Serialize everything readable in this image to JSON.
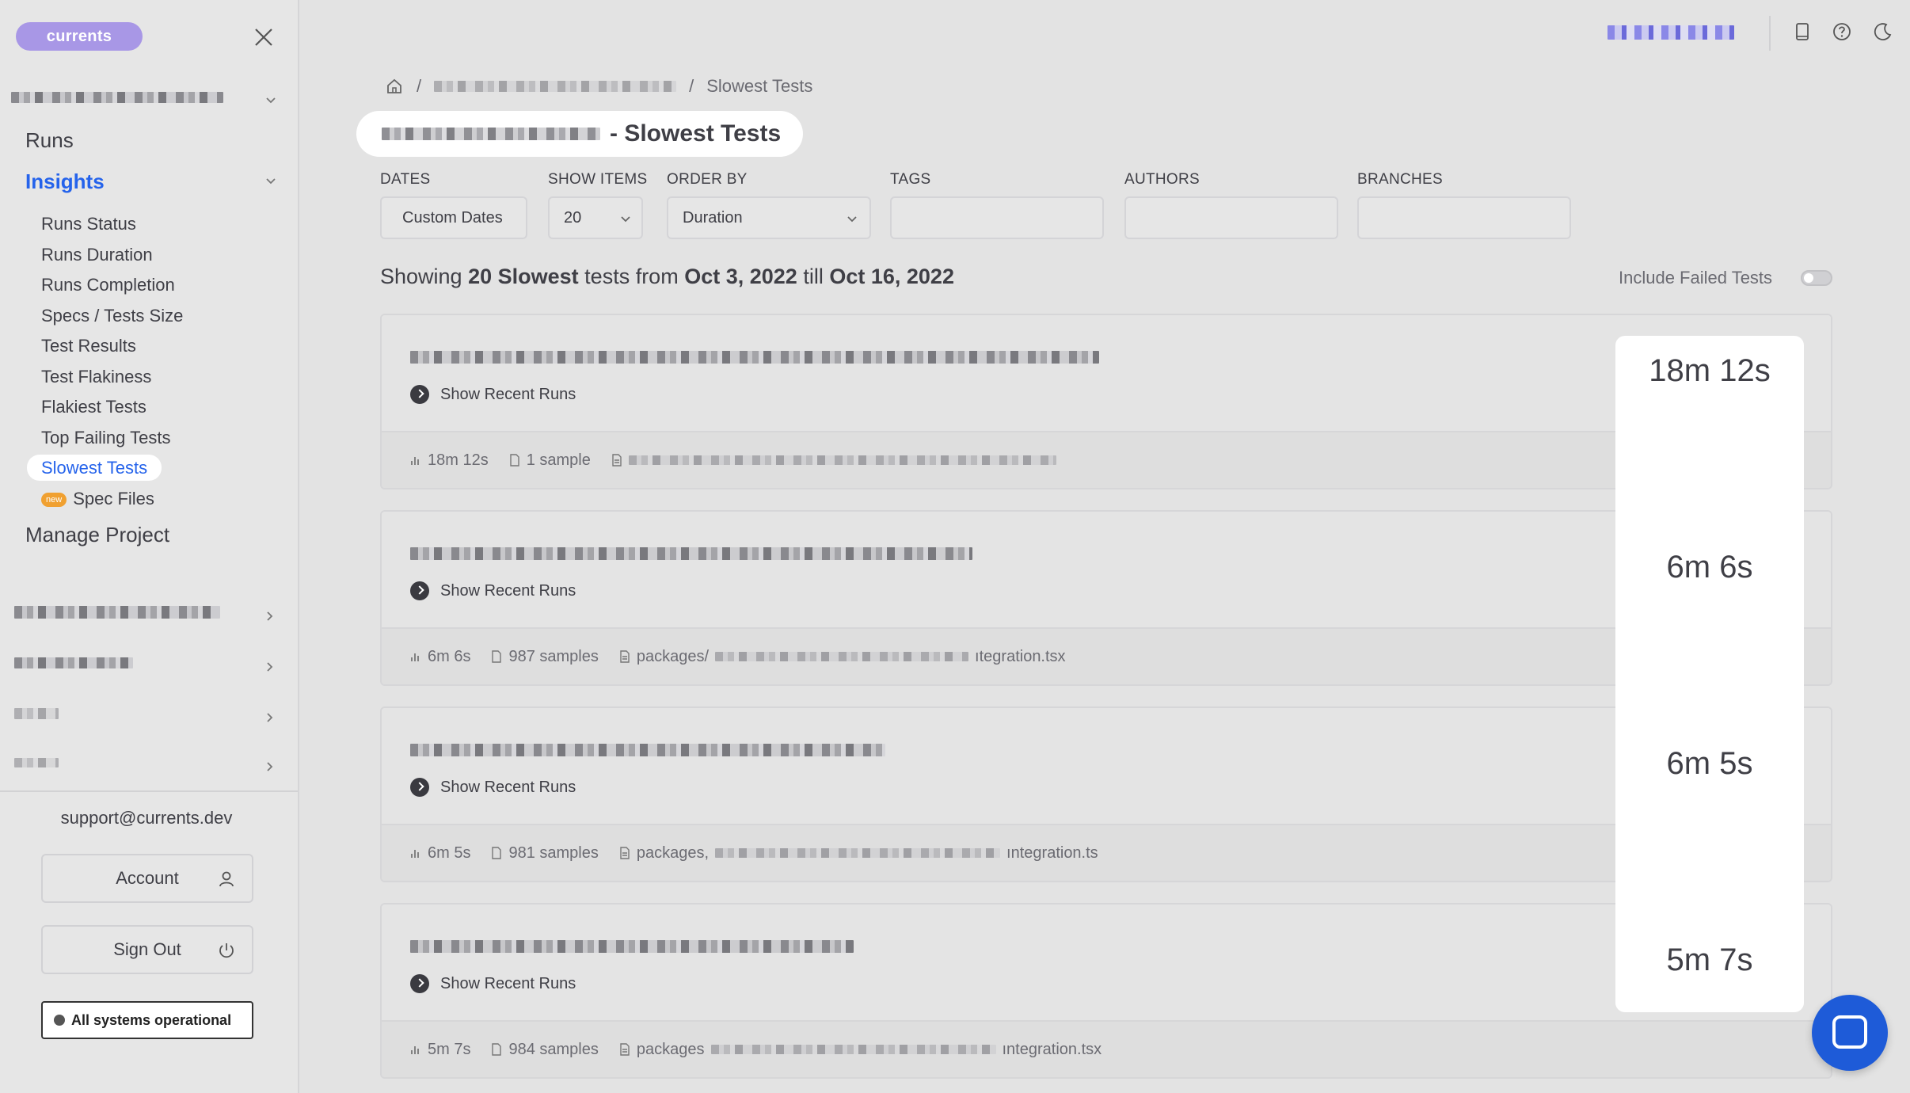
{
  "sidebar": {
    "logo": "currents",
    "nav": {
      "runs": "Runs",
      "insights": "Insights",
      "manage": "Manage Project"
    },
    "insights_items": [
      {
        "label": "Runs Status"
      },
      {
        "label": "Runs Duration"
      },
      {
        "label": "Runs Completion"
      },
      {
        "label": "Specs / Tests Size"
      },
      {
        "label": "Test Results"
      },
      {
        "label": "Test Flakiness"
      },
      {
        "label": "Flakiest Tests"
      },
      {
        "label": "Top Failing Tests"
      },
      {
        "label": "Slowest Tests",
        "active": true
      },
      {
        "label": "Spec Files",
        "badge": "new"
      }
    ],
    "support_email": "support@currents.dev",
    "account_label": "Account",
    "signout_label": "Sign Out",
    "status_label": "All systems operational"
  },
  "breadcrumb": {
    "current": "Slowest Tests",
    "separator": "/"
  },
  "title": {
    "suffix": "- Slowest Tests"
  },
  "filters": {
    "dates": {
      "label": "DATES",
      "value": "Custom Dates"
    },
    "show_items": {
      "label": "SHOW ITEMS",
      "value": "20"
    },
    "order_by": {
      "label": "ORDER BY",
      "value": "Duration"
    },
    "tags": {
      "label": "TAGS",
      "value": ""
    },
    "authors": {
      "label": "AUTHORS",
      "value": ""
    },
    "branches": {
      "label": "BRANCHES",
      "value": ""
    }
  },
  "summary": {
    "prefix": "Showing",
    "count": "20 Slowest",
    "middle": "tests from",
    "from": "Oct 3, 2022",
    "till_word": "till",
    "to": "Oct 16, 2022"
  },
  "include_failed": {
    "label": "Include Failed Tests",
    "on": false
  },
  "tests": [
    {
      "duration": "18m 12s",
      "recent_label": "Show Recent Runs",
      "meta_duration": "18m 12s",
      "samples": "1 sample",
      "file_prefix": "",
      "file_suffix": ""
    },
    {
      "duration": "6m 6s",
      "recent_label": "Show Recent Runs",
      "meta_duration": "6m 6s",
      "samples": "987 samples",
      "file_prefix": "packages/",
      "file_suffix": "ıtegration.tsx"
    },
    {
      "duration": "6m 5s",
      "recent_label": "Show Recent Runs",
      "meta_duration": "6m 5s",
      "samples": "981 samples",
      "file_prefix": "packages,",
      "file_suffix": "ıntegration.ts"
    },
    {
      "duration": "5m 7s",
      "recent_label": "Show Recent Runs",
      "meta_duration": "5m 7s",
      "samples": "984 samples",
      "file_prefix": "packages",
      "file_suffix": "ıntegration.tsx"
    }
  ],
  "colors": {
    "accent": "#2563eb",
    "logo": "#a897e6",
    "chat": "#1e5bd8"
  }
}
